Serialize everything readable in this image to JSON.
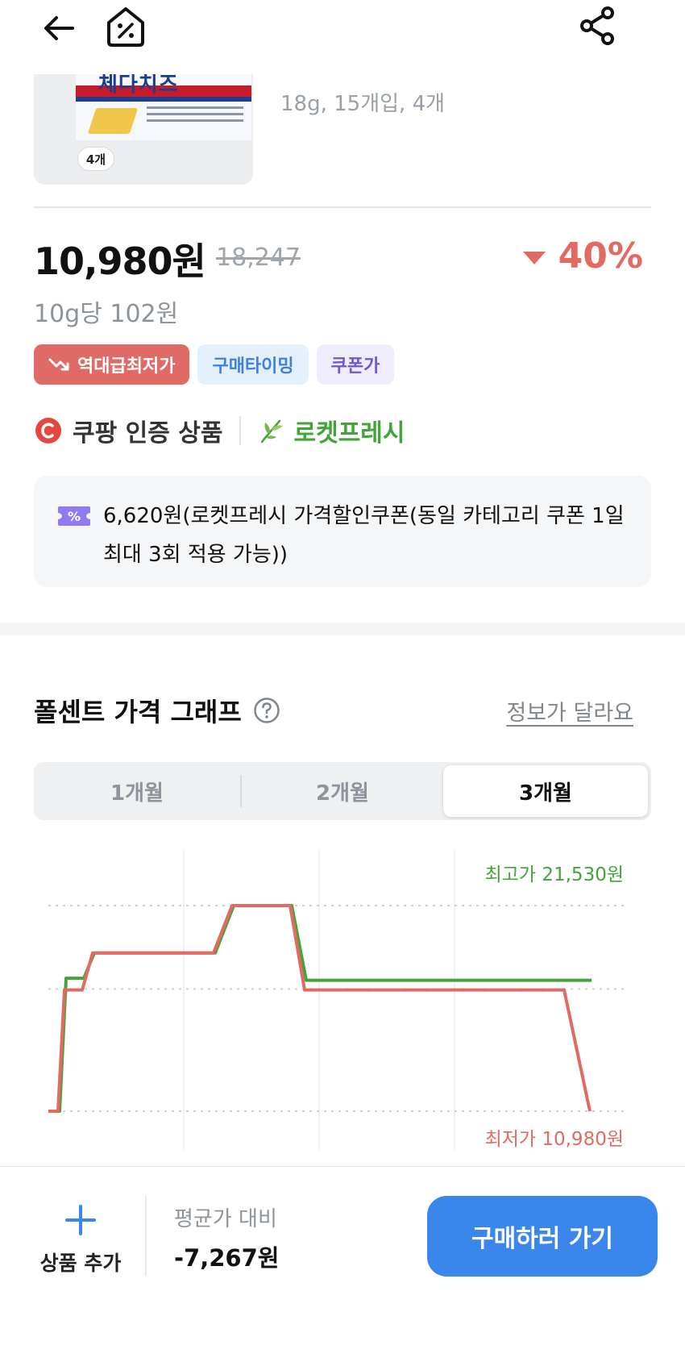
{
  "product": {
    "pack_brand": "체다치즈",
    "quantity_badge": "4개",
    "subtitle": "18g, 15개입, 4개"
  },
  "pricing": {
    "price": "10,980원",
    "original_price": "18,247",
    "discount": "40%",
    "unit_price": "10g당 102원"
  },
  "badges": [
    {
      "label": "역대급최저가",
      "color": "#e06a66"
    },
    {
      "label": "구매타이밍",
      "color": "#3e7fe3"
    },
    {
      "label": "쿠폰가",
      "color": "#6b58d6"
    }
  ],
  "certification": {
    "coupang_label": "쿠팡 인증 상품",
    "fresh_label": "로켓프레시"
  },
  "coupon": {
    "text": "6,620원(로켓프레시 가격할인쿠폰(동일 카테고리 쿠폰 1일 최대 3회 적용 가능))"
  },
  "graph": {
    "title": "폴센트 가격 그래프",
    "report_link": "정보가 달라요",
    "tabs": [
      "1개월",
      "2개월",
      "3개월"
    ],
    "active_tab": "3개월",
    "max_label": "최고가 21,530원",
    "min_label": "최저가 10,980원"
  },
  "chart_data": {
    "type": "line",
    "ylim": [
      10980,
      21530
    ],
    "grid": true,
    "series": [
      {
        "color": "#43a43a",
        "y": [
          10980,
          10980,
          17800,
          17800,
          19100,
          19100,
          19100,
          21530,
          21530,
          17700,
          17700,
          17700,
          17700,
          17700
        ]
      },
      {
        "color": "#e26a62",
        "y": [
          10980,
          10980,
          17200,
          17200,
          19100,
          19100,
          19100,
          21530,
          21530,
          17200,
          17200,
          17200,
          17200,
          10980
        ]
      }
    ]
  },
  "bottom_bar": {
    "add_label": "상품 추가",
    "avg_label": "평균가 대비",
    "avg_value": "-7,267원",
    "buy_label": "구매하러 가기"
  },
  "colors": {
    "accent": "#3a86ea",
    "discount": "#e26a62",
    "fresh_green": "#43a43a"
  }
}
